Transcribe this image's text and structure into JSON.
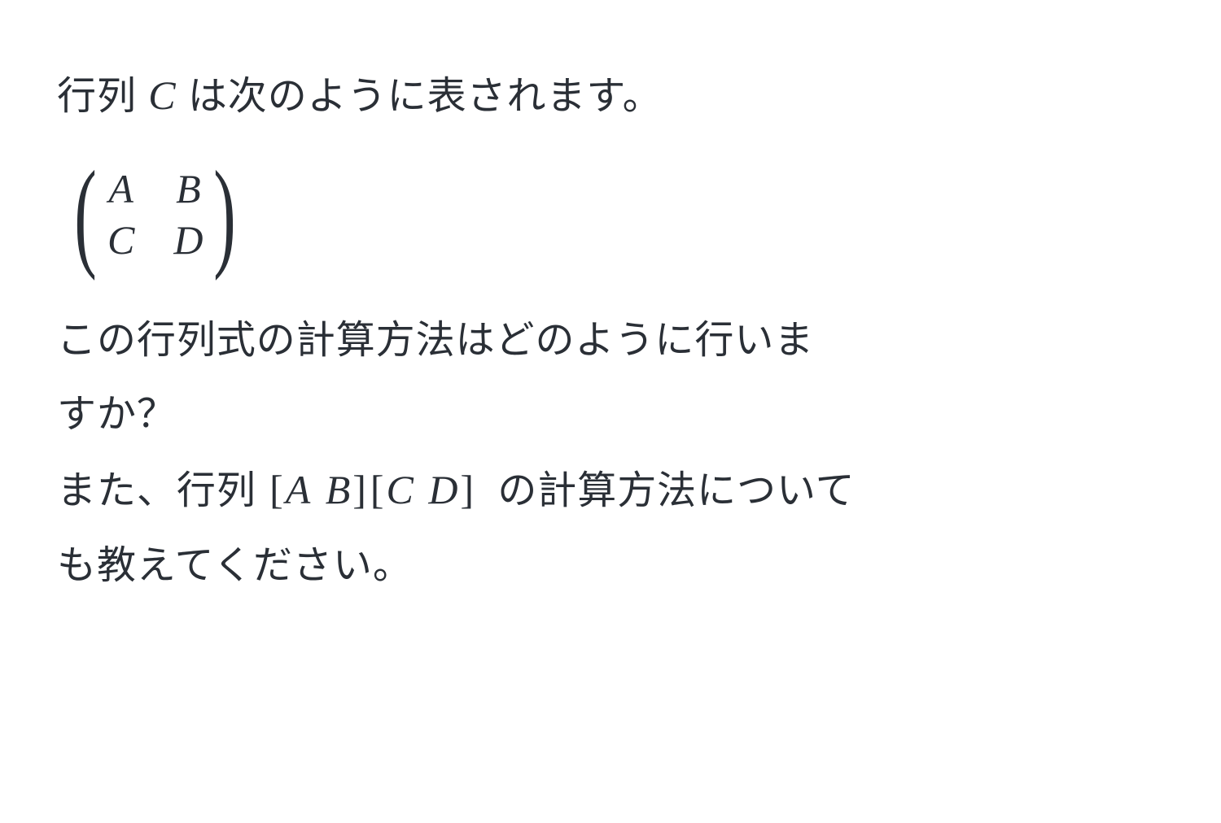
{
  "line1": {
    "pre": "行列 ",
    "var": "C",
    "post": " は次のように表されます。"
  },
  "matrix": {
    "a": "A",
    "b": "B",
    "c": "C",
    "d": "D"
  },
  "line2a": "この行列式の計算方法はどのように行いま",
  "line2b": "すか？",
  "line3": {
    "pre": "また、行列 ",
    "br_open": "[",
    "a": "A",
    "b": "B",
    "br_close": "]",
    "c": "C",
    "d": "D",
    "post": " の計算方法について"
  },
  "line4": "も教えてください。"
}
